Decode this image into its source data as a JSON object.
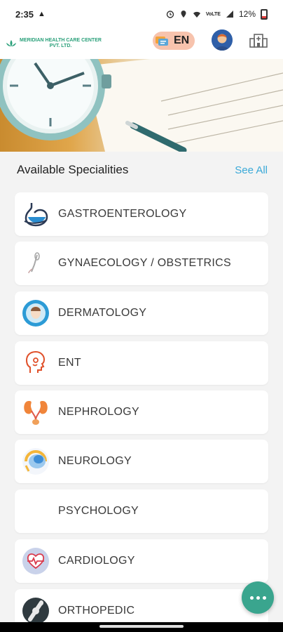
{
  "status_bar": {
    "time": "2:35",
    "battery": "12%",
    "network": "VoLTE"
  },
  "header": {
    "logo_line1": "MERIDIAN HEALTH CARE CENTER",
    "logo_line2": "PVT. LTD.",
    "language": "EN",
    "icons": [
      "language-flag-icon",
      "user-avatar-icon",
      "hospital-icon"
    ]
  },
  "section": {
    "title": "Available Specialities",
    "see_all": "See All"
  },
  "specialities": [
    {
      "label": "GASTROENTEROLOGY",
      "icon": "stomach-icon"
    },
    {
      "label": "GYNAECOLOGY / OBSTETRICS",
      "icon": "ultrasound-probe-icon"
    },
    {
      "label": "DERMATOLOGY",
      "icon": "face-skin-icon"
    },
    {
      "label": "ENT",
      "icon": "ear-nose-throat-icon"
    },
    {
      "label": "NEPHROLOGY",
      "icon": "kidneys-icon"
    },
    {
      "label": "NEUROLOGY",
      "icon": "brain-icon"
    },
    {
      "label": "PSYCHOLOGY",
      "icon": ""
    },
    {
      "label": "CARDIOLOGY",
      "icon": "heart-pulse-icon"
    },
    {
      "label": "ORTHOPEDIC",
      "icon": "bone-joint-icon"
    }
  ],
  "colors": {
    "accent": "#3aa9d8",
    "fab": "#3aa58e",
    "brand_green": "#2aa07a",
    "language_pill": "#f7c3ad"
  }
}
